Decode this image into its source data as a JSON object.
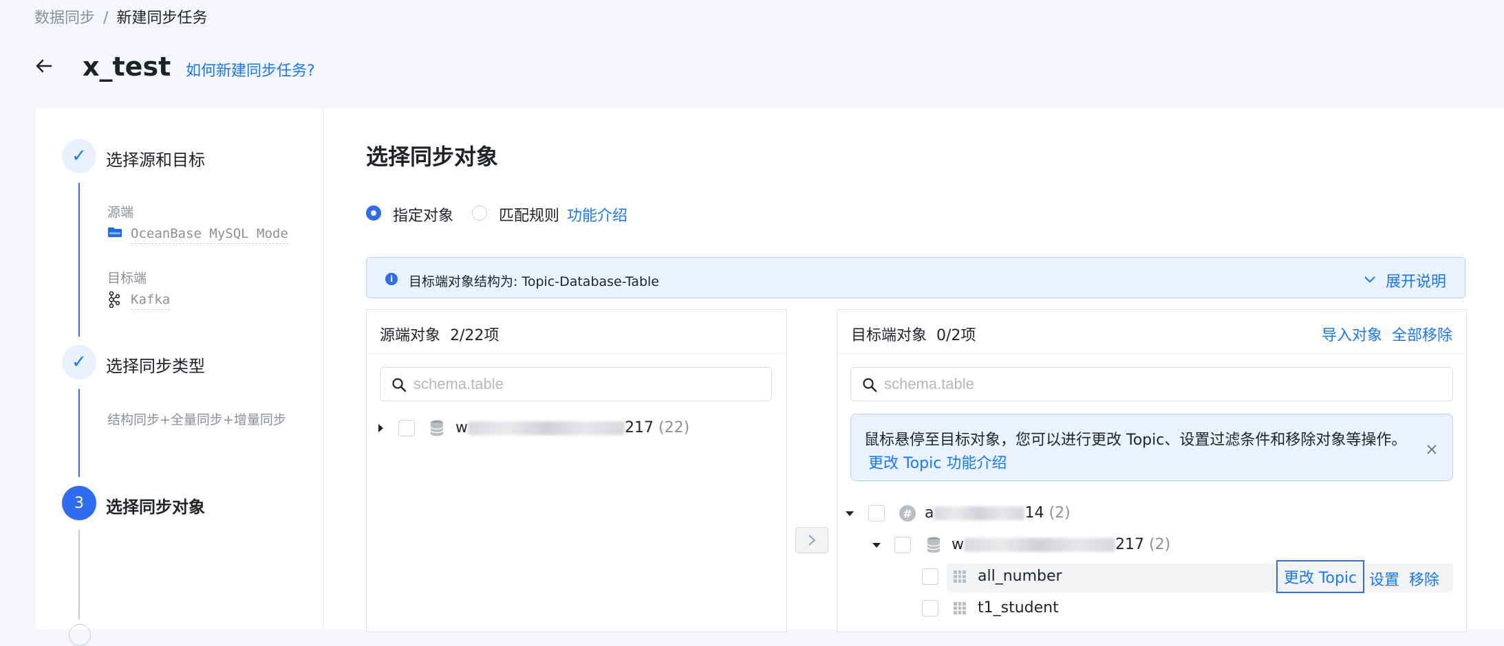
{
  "breadcrumb": {
    "parent": "数据同步",
    "separator": "/",
    "current": "新建同步任务"
  },
  "header": {
    "title": "x_test",
    "help_link": "如何新建同步任务?"
  },
  "steps": [
    {
      "label": "选择源和目标",
      "status": "done"
    },
    {
      "label": "选择同步类型",
      "status": "done"
    },
    {
      "label": "选择同步对象",
      "status": "active",
      "number": "3"
    }
  ],
  "step1_details": {
    "source_label": "源端",
    "source_value": "OceanBase MySQL Mode",
    "target_label": "目标端",
    "target_value": "Kafka"
  },
  "step2_details": {
    "value": "结构同步+全量同步+增量同步"
  },
  "main": {
    "title": "选择同步对象",
    "radio_specified": "指定对象",
    "radio_rules": "匹配规则",
    "feature_link": "功能介绍"
  },
  "infobar": {
    "text": "目标端对象结构为: Topic-Database-Table",
    "expand": "展开说明"
  },
  "source_panel": {
    "title": "源端对象",
    "count": "2/22项",
    "search_placeholder": "schema.table",
    "tree": [
      {
        "prefix": "w",
        "suffix": "217",
        "count": "(22)"
      }
    ]
  },
  "target_panel": {
    "title": "目标端对象",
    "count": "0/2项",
    "import_action": "导入对象",
    "remove_all_action": "全部移除",
    "search_placeholder": "schema.table",
    "tip_text": "鼠标悬停至目标对象，您可以进行更改 Topic、设置过滤条件和移除对象等操作。",
    "tip_link": "更改 Topic 功能介绍",
    "tree": {
      "topic": {
        "prefix": "a",
        "suffix": "14",
        "count": "(2)"
      },
      "database": {
        "prefix": "w",
        "suffix": "217",
        "count": "(2)"
      },
      "tables": [
        "all_number",
        "t1_student"
      ]
    },
    "row_actions": {
      "change_topic": "更改 Topic",
      "settings": "设置",
      "remove": "移除"
    }
  },
  "colors": {
    "primary": "#2f6cf1",
    "link": "#1677ff",
    "info_bg": "#eaf2ff"
  }
}
